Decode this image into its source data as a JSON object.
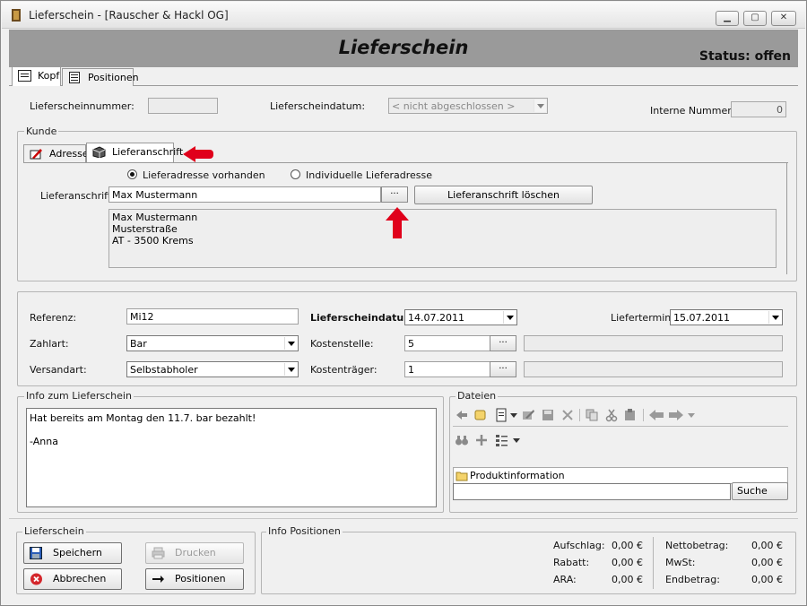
{
  "window": {
    "title": "Lieferschein - [Rauscher & Hackl OG]"
  },
  "banner": {
    "title": "Lieferschein",
    "status": "Status: offen"
  },
  "main_tabs": [
    {
      "label": "Kopf"
    },
    {
      "label": "Positionen"
    }
  ],
  "header": {
    "nummer_label": "Lieferscheinnummer:",
    "nummer_value": "",
    "datum_label": "Lieferscheindatum:",
    "datum_value": "< nicht abgeschlossen >",
    "intern_label": "Interne Nummer:",
    "intern_value": "0"
  },
  "kunde": {
    "legend": "Kunde",
    "tabs": [
      {
        "label": "Adresse"
      },
      {
        "label": "Lieferanschrift"
      }
    ],
    "radio_vorhanden": "Lieferadresse vorhanden",
    "radio_individuell": "Individuelle Lieferadresse",
    "anschrift_label": "Lieferanschrift",
    "anschrift_value": "Max Mustermann",
    "browse_label": "...",
    "loeschen_label": "Lieferanschrift löschen",
    "address_lines": [
      "Max Mustermann",
      "Musterstraße",
      "AT - 3500 Krems"
    ]
  },
  "details": {
    "referenz_label": "Referenz:",
    "referenz_value": "Mi12",
    "zahlart_label": "Zahlart:",
    "zahlart_value": "Bar",
    "versandart_label": "Versandart:",
    "versandart_value": "Selbstabholer",
    "datum_label": "Lieferscheindatum:",
    "datum_value": "14.07.2011",
    "kostenstelle_label": "Kostenstelle:",
    "kostenstelle_value": "5",
    "kostentraeger_label": "Kostenträger:",
    "kostentraeger_value": "1",
    "liefertermin_label": "Liefertermin:",
    "liefertermin_value": "15.07.2011",
    "browse_label": "..."
  },
  "info": {
    "legend": "Info zum Lieferschein",
    "lines": [
      "Hat bereits am Montag den 11.7. bar bezahlt!",
      "",
      "-Anna"
    ]
  },
  "dateien": {
    "legend": "Dateien",
    "folder_label": "Produktinformation",
    "search_value": "",
    "search_button": "Suche"
  },
  "footer": {
    "legend": "Lieferschein",
    "speichern": "Speichern",
    "drucken": "Drucken",
    "abbrechen": "Abbrechen",
    "positionen": "Positionen",
    "info_legend": "Info Positionen",
    "aufschlag_label": "Aufschlag:",
    "aufschlag_value": "0,00 €",
    "rabatt_label": "Rabatt:",
    "rabatt_value": "0,00 €",
    "ara_label": "ARA:",
    "ara_value": "0,00 €",
    "netto_label": "Nettobetrag:",
    "netto_value": "0,00 €",
    "mwst_label": "MwSt:",
    "mwst_value": "0,00 €",
    "end_label": "Endbetrag:",
    "end_value": "0,00 €"
  },
  "colors": {
    "annotation_arrow": "#e0001b",
    "banner_bg": "#9a9a9a"
  }
}
